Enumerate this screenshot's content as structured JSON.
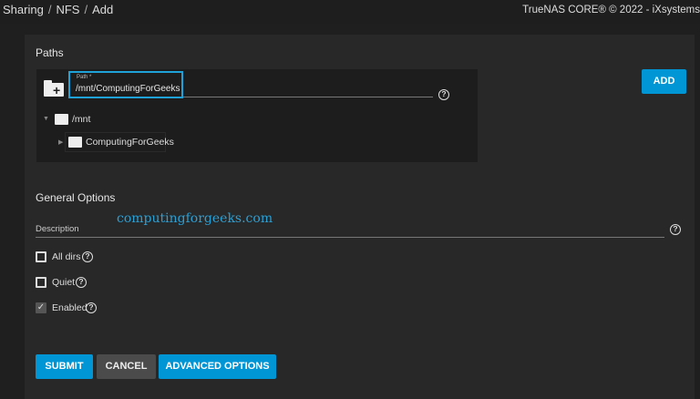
{
  "breadcrumb": [
    "Sharing",
    "NFS",
    "Add"
  ],
  "brand": "TrueNAS CORE® © 2022 - iXsystems",
  "paths": {
    "title": "Paths",
    "path_label": "Path *",
    "path_value": "/mnt/ComputingForGeeks",
    "add_label": "ADD",
    "tree": [
      {
        "label": "/mnt",
        "expanded": true
      },
      {
        "label": "ComputingForGeeks",
        "expanded": false
      }
    ]
  },
  "general": {
    "title": "General Options",
    "description_label": "Description",
    "checkboxes": [
      {
        "label": "All dirs",
        "checked": false
      },
      {
        "label": "Quiet",
        "checked": false
      },
      {
        "label": "Enabled",
        "checked": true
      }
    ]
  },
  "buttons": {
    "submit": "SUBMIT",
    "cancel": "CANCEL",
    "advanced": "ADVANCED OPTIONS"
  },
  "watermark": "computingforgeeks.com",
  "colors": {
    "accent": "#0095d5"
  }
}
